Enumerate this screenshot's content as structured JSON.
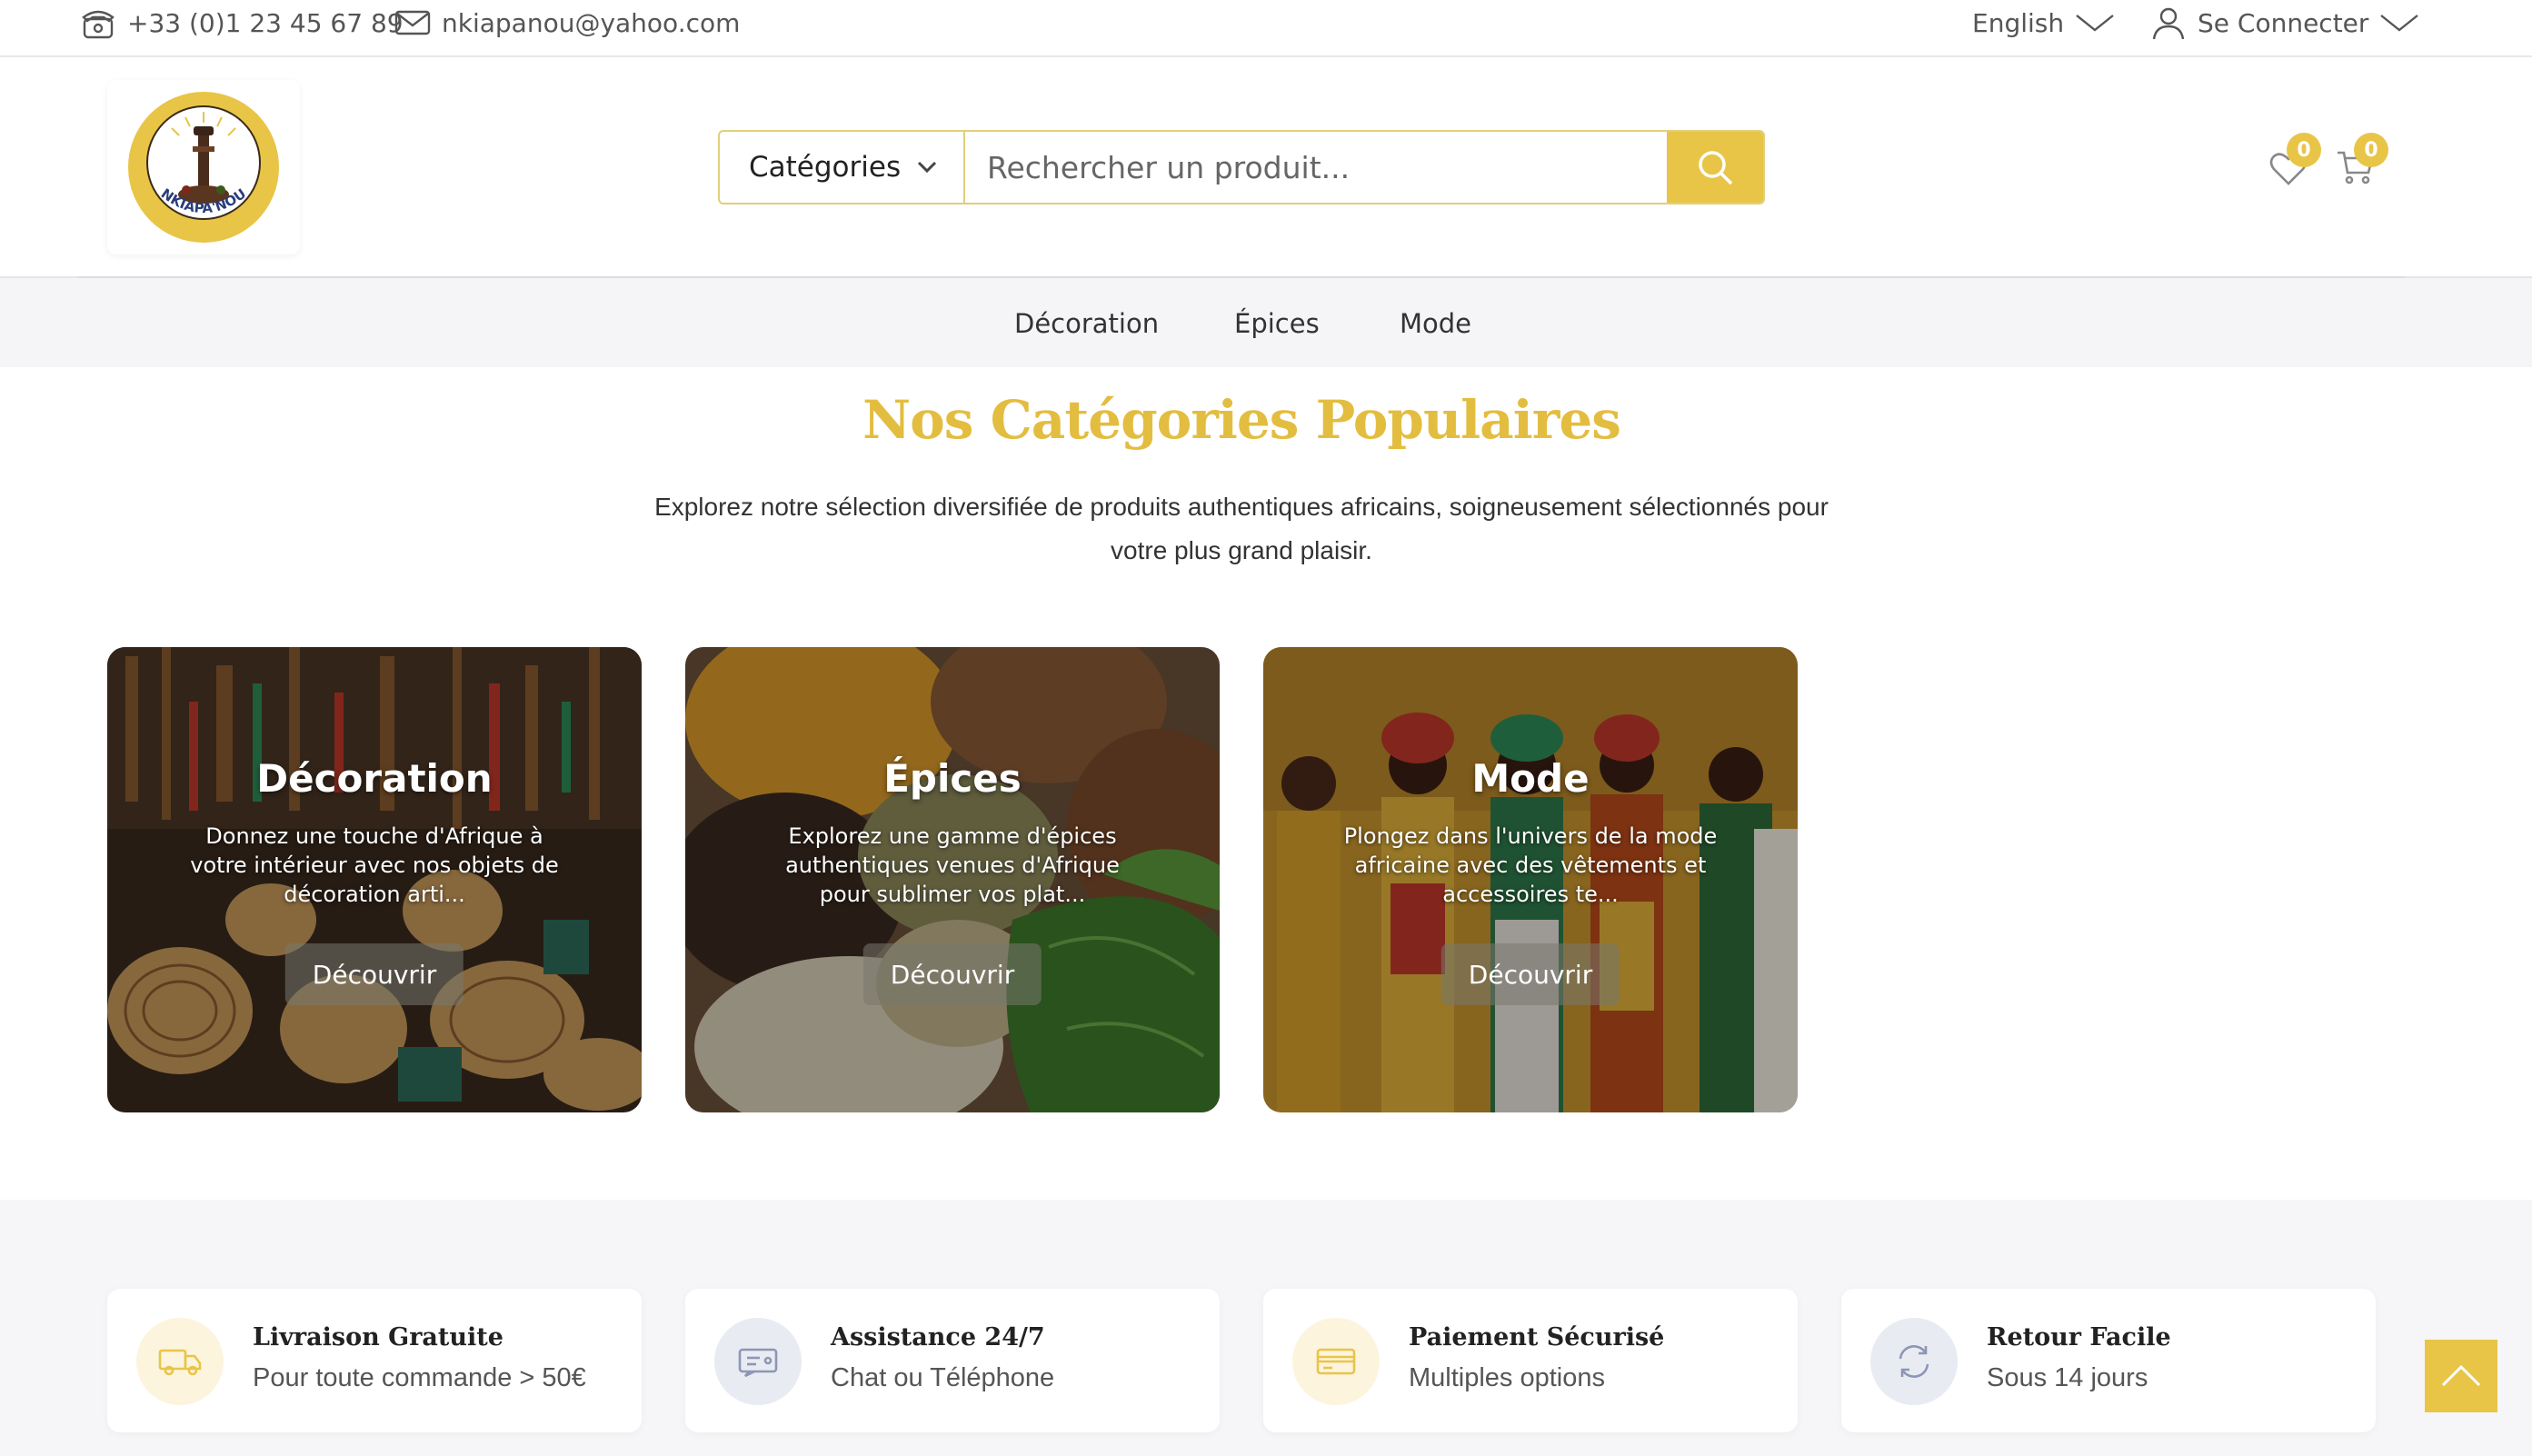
{
  "topbar": {
    "phone": "+33 (0)1 23 45 67 89",
    "email": "nkiapanou@yahoo.com",
    "language": "English",
    "login": "Se Connecter"
  },
  "header": {
    "logo_text": "NKIAPA'NOU",
    "category_select": "Catégories",
    "search_placeholder": "Rechercher un produit...",
    "wishlist_count": "0",
    "cart_count": "0"
  },
  "nav": {
    "items": [
      "Décoration",
      "Épices",
      "Mode"
    ]
  },
  "section": {
    "title": "Nos Catégories Populaires",
    "description": "Explorez notre sélection diversifiée de produits authentiques africains, soigneusement sélectionnés pour votre plus grand plaisir."
  },
  "categories": [
    {
      "title": "Décoration",
      "description": "Donnez une touche d'Afrique à votre intérieur avec nos objets de décoration arti...",
      "button": "Découvrir"
    },
    {
      "title": "Épices",
      "description": "Explorez une gamme d'épices authentiques venues d'Afrique pour sublimer vos plat...",
      "button": "Découvrir"
    },
    {
      "title": "Mode",
      "description": "Plongez dans l'univers de la mode africaine avec des vêtements et accessoires te...",
      "button": "Découvrir"
    }
  ],
  "features": [
    {
      "title": "Livraison Gratuite",
      "subtitle": "Pour toute commande > 50€",
      "icon": "truck-icon"
    },
    {
      "title": "Assistance 24/7",
      "subtitle": "Chat ou Téléphone",
      "icon": "ticket-icon"
    },
    {
      "title": "Paiement Sécurisé",
      "subtitle": "Multiples options",
      "icon": "card-icon"
    },
    {
      "title": "Retour Facile",
      "subtitle": "Sous 14 jours",
      "icon": "refresh-icon"
    }
  ],
  "colors": {
    "accent": "#e8c547",
    "title": "#e3bd3f",
    "nav_bg": "#f5f5f7"
  }
}
